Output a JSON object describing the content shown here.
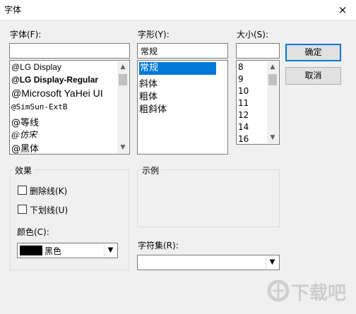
{
  "window": {
    "title": "字体",
    "close_icon": "×"
  },
  "font": {
    "label": "字体(F):",
    "value": "",
    "items": [
      "@LG Display",
      "@LG Display-Regular",
      "@Microsoft YaHei UI",
      "@SimSun-ExtB",
      "@等线",
      "@仿宋",
      "@黑体"
    ]
  },
  "style": {
    "label": "字形(Y):",
    "value": "常规",
    "items": [
      "常规",
      "斜体",
      "粗体",
      "粗斜体"
    ],
    "selected_index": 0
  },
  "size": {
    "label": "大小(S):",
    "value": "",
    "items": [
      "8",
      "9",
      "10",
      "11",
      "12",
      "14",
      "16"
    ]
  },
  "buttons": {
    "ok": "确定",
    "cancel": "取消"
  },
  "effects": {
    "group_label": "效果",
    "strikeout": {
      "label": "删除线(K)",
      "checked": false
    },
    "underline": {
      "label": "下划线(U)",
      "checked": false
    },
    "color_label": "颜色(C):",
    "color_value": "黑色",
    "color_swatch": "#000000"
  },
  "sample": {
    "group_label": "示例"
  },
  "charset": {
    "label": "字符集(R):",
    "value": ""
  },
  "scroll_icons": {
    "up": "▲",
    "down": "▼"
  },
  "dropdown_icon": "▼",
  "watermark": "下载吧",
  "colors": {
    "selection": "#0078d7",
    "default_button_border": "#0078d7"
  }
}
